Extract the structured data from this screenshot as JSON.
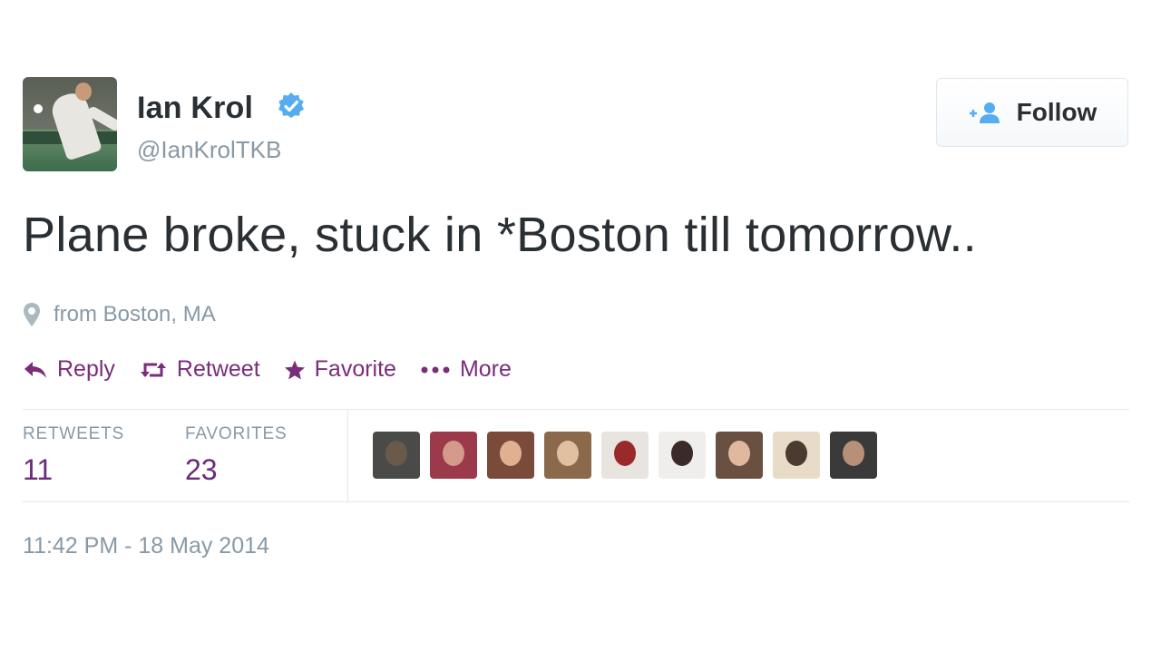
{
  "user": {
    "name": "Ian Krol",
    "handle": "@IanKrolTKB",
    "verified": true
  },
  "follow_button": {
    "label": "Follow",
    "icon": "add-user-icon"
  },
  "tweet": {
    "text": "Plane broke, stuck in *Boston till tomorrow..",
    "location": "from Boston, MA",
    "timestamp": "11:42 PM - 18 May 2014"
  },
  "actions": [
    {
      "label": "Reply",
      "icon": "reply-icon"
    },
    {
      "label": "Retweet",
      "icon": "retweet-icon"
    },
    {
      "label": "Favorite",
      "icon": "star-icon"
    },
    {
      "label": "More",
      "icon": "more-dots-icon"
    }
  ],
  "stats": {
    "retweets_label": "RETWEETS",
    "retweets": "11",
    "favorites_label": "FAVORITES",
    "favorites": "23"
  },
  "colors": {
    "action_purple": "#7a2d7a",
    "count_purple": "#6b2a7a",
    "verified_blue": "#55acee",
    "muted_gray": "#8899a6"
  },
  "favoriters": [
    {
      "bg": "#4a4a48",
      "face": "#6a5a4a"
    },
    {
      "bg": "#9a3a4a",
      "face": "#d49a8a"
    },
    {
      "bg": "#7a4a3a",
      "face": "#e0b090"
    },
    {
      "bg": "#8a6a4a",
      "face": "#e0c0a0"
    },
    {
      "bg": "#e8e4e0",
      "face": "#9a2a2a"
    },
    {
      "bg": "#f0eeec",
      "face": "#3a2a2a"
    },
    {
      "bg": "#6a5040",
      "face": "#e0b8a0"
    },
    {
      "bg": "#e8dcc8",
      "face": "#4a3a30"
    },
    {
      "bg": "#3a3a3a",
      "face": "#b89078"
    }
  ]
}
